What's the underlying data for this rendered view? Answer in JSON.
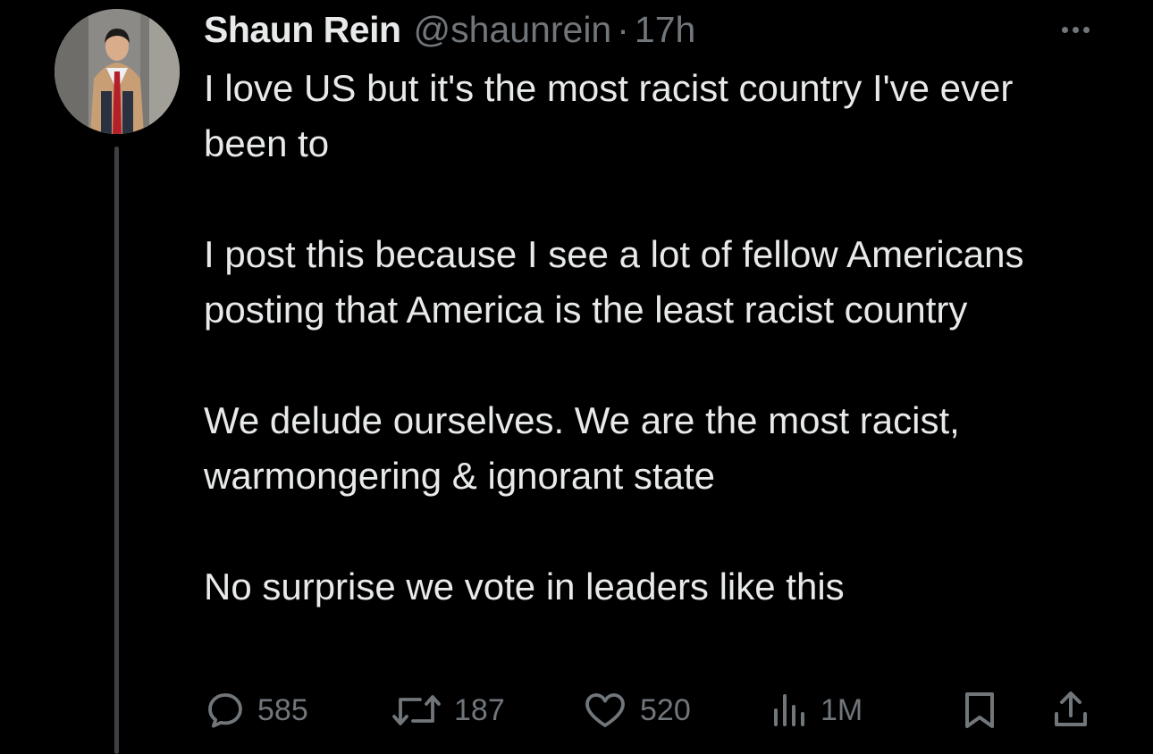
{
  "tweet": {
    "author_name": "Shaun Rein",
    "handle": "@shaunrein",
    "separator": "·",
    "time": "17h",
    "paragraphs": [
      "I love US but it's the most racist country I've ever been to",
      "I post this because I see a lot of fellow Americans posting that America is the least racist country",
      "We delude ourselves. We are the most racist, warmongering & ignorant state",
      "No surprise we vote in leaders like this"
    ]
  },
  "actions": {
    "replies": "585",
    "reposts": "187",
    "likes": "520",
    "views": "1M"
  },
  "icons": {
    "reply": "reply-icon",
    "repost": "repost-icon",
    "like": "heart-icon",
    "views": "views-chart-icon",
    "bookmark": "bookmark-icon",
    "share": "share-icon",
    "more": "more-dots-icon"
  },
  "colors": {
    "background": "#000000",
    "primary_text": "#e7e9ea",
    "secondary_text": "#71767b",
    "thread_line": "#3e4144"
  }
}
